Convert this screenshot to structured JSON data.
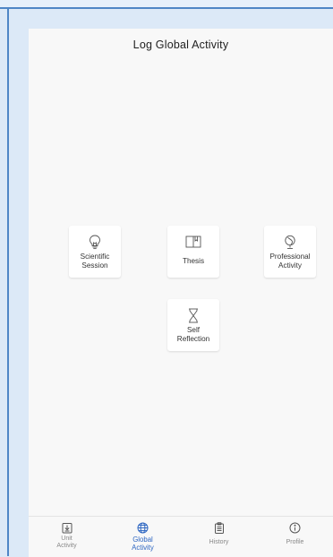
{
  "page": {
    "title": "Log Global Activity"
  },
  "activities": [
    {
      "label": "Scientific\nSession",
      "icon": "lightbulb-icon"
    },
    {
      "label": "Thesis",
      "icon": "book-icon"
    },
    {
      "label": "Professional\nActivity",
      "icon": "globe-icon"
    },
    {
      "label": "Self\nReflection",
      "icon": "hourglass-icon"
    }
  ],
  "nav": {
    "active": "Global Activity",
    "items": [
      {
        "label": "Unit\nActivity",
        "icon": "download-box-icon"
      },
      {
        "label": "Global\nActivity",
        "icon": "globe-icon"
      },
      {
        "label": "History",
        "icon": "clipboard-icon"
      },
      {
        "label": "Profile",
        "icon": "info-icon"
      }
    ]
  },
  "colors": {
    "accent": "#2f67c2",
    "inactive": "#888888",
    "border": "#4f86c6"
  }
}
